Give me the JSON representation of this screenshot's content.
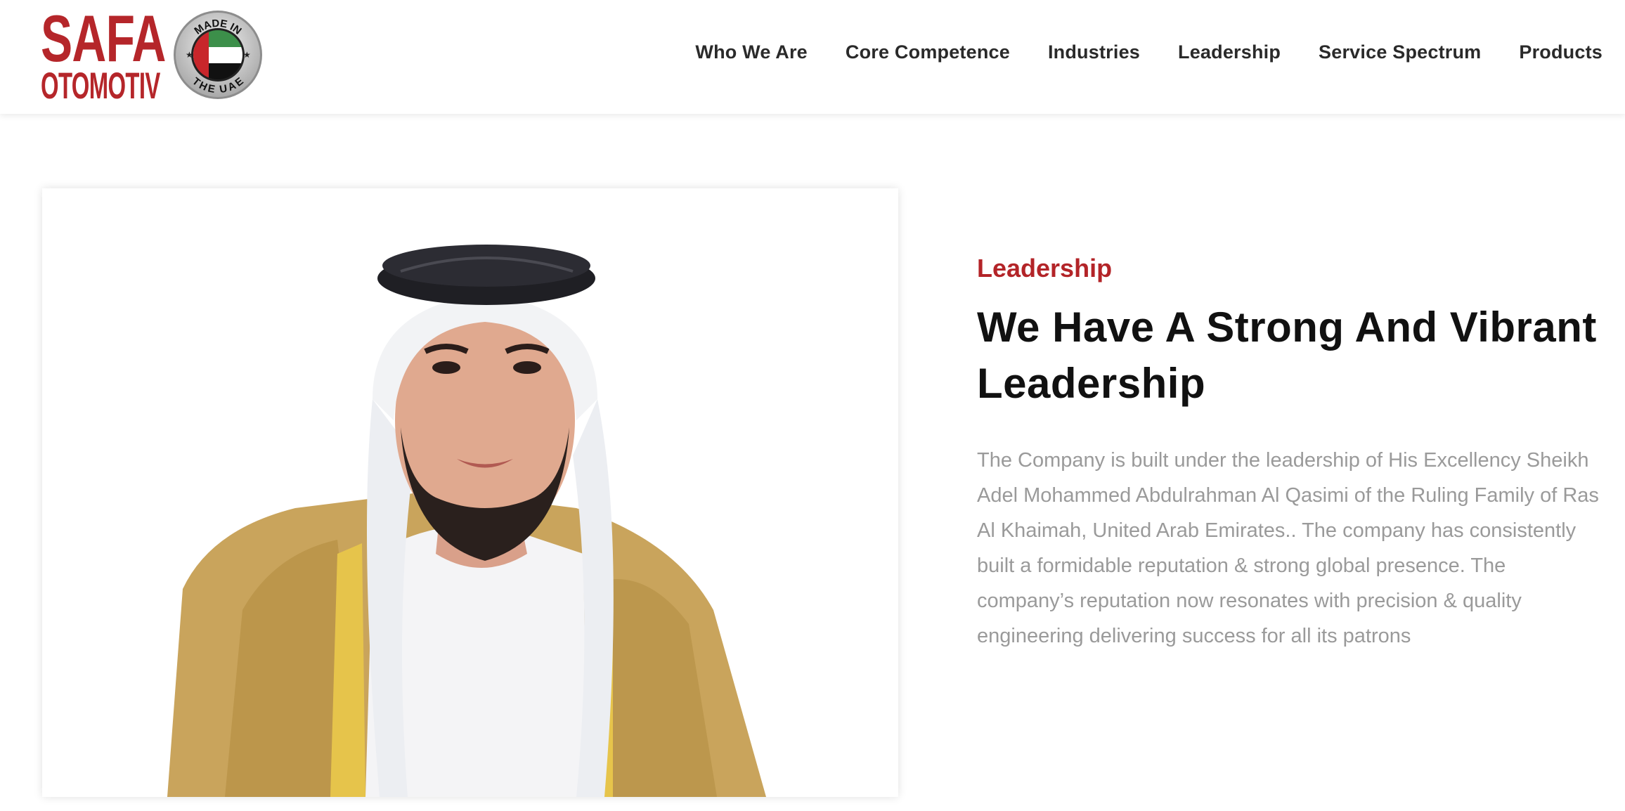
{
  "brand": {
    "logo_line1": "SAFA",
    "logo_line2": "OTOMOTIV",
    "badge_top": "MADE IN",
    "badge_bottom": "THE UAE",
    "brand_color": "#b5262a"
  },
  "nav": {
    "items": [
      {
        "label": "Who We Are"
      },
      {
        "label": "Core Competence"
      },
      {
        "label": "Industries"
      },
      {
        "label": "Leadership"
      },
      {
        "label": "Service Spectrum"
      },
      {
        "label": "Products"
      }
    ]
  },
  "leadership": {
    "eyebrow": "Leadership",
    "heading": "We Have A Strong And Vibrant Leadership",
    "body": "The Company is built under the leadership of His Excellency Sheikh Adel Mohammed Abdulrahman Al Qasimi of the Ruling Family of Ras Al Khaimah, United Arab Emirates.. The company has consistently built a formidable reputation & strong global presence. The company’s reputation now resonates with precision & quality engineering delivering success for all its patrons",
    "accent_color": "#b32428"
  },
  "icons": {
    "flag": "uae-flag-icon",
    "portrait": "portrait-image"
  }
}
